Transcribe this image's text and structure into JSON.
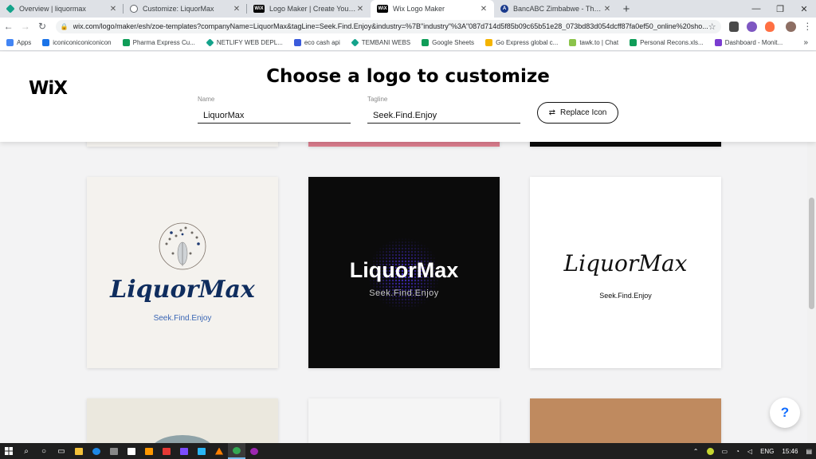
{
  "browser": {
    "tabs": [
      {
        "title": "Overview | liquormax",
        "favicon": "netlify-diamond-icon",
        "color": "#14a38b",
        "glyph": ""
      },
      {
        "title": "Customize: LiquorMax",
        "favicon": "globe-icon",
        "color": "#5f6368",
        "glyph": ""
      },
      {
        "title": "Logo Maker | Create Your Own F",
        "favicon": "wix-icon",
        "color": "#000000",
        "glyph": "WiX"
      },
      {
        "title": "Wix Logo Maker",
        "favicon": "wix-icon",
        "color": "#000000",
        "glyph": "WiX"
      },
      {
        "title": "BancABC Zimbabwe - The #ATeam",
        "favicon": "bancabc-icon",
        "color": "#1a3a8c",
        "glyph": "A"
      }
    ],
    "active_tab": 3,
    "url": "wix.com/logo/maker/esh/zoe-templates?companyName=LiquorMax&tagLine=Seek.Find.Enjoy&industry=%7B\"industry\"%3A\"087d714d5f85b09c65b51e28_073bd83d054dcff87fa0ef50_online%20sho...",
    "bookmarks": [
      {
        "label": "Apps",
        "color": "#4285f4"
      },
      {
        "label": "iconiconiconiconicon",
        "color": "#1a73e8"
      },
      {
        "label": "Pharma Express Cu...",
        "color": "#0f9d58"
      },
      {
        "label": "NETLIFY WEB DEPL...",
        "color": "#14a38b"
      },
      {
        "label": "eco cash api",
        "color": "#3b5bdb"
      },
      {
        "label": "TEMBANI WEBS",
        "color": "#14a38b"
      },
      {
        "label": "Google Sheets",
        "color": "#0f9d58"
      },
      {
        "label": "Go Express global c...",
        "color": "#f4b400"
      },
      {
        "label": "tawk.to | Chat",
        "color": "#8bc34a"
      },
      {
        "label": "Personal Recons.xls...",
        "color": "#0f9d58"
      },
      {
        "label": "Dashboard - Monit...",
        "color": "#7a3cd0"
      }
    ],
    "more_glyph": "»"
  },
  "wix": {
    "logo": "WiX",
    "title": "Choose a logo to customize",
    "name_label": "Name",
    "name_value": "LiquorMax",
    "tagline_label": "Tagline",
    "tagline_value": "Seek.Find.Enjoy",
    "replace_icon_label": "Replace Icon",
    "help_label": "?"
  },
  "logos": [
    {
      "brand": "LiquorMax",
      "tagline": "Seek.Find.Enjoy",
      "bg": "#f4f2ee",
      "brand_color": "#0f2d5e",
      "tagline_color": "#3a66b4"
    },
    {
      "brand": "LiquorMax",
      "tagline": "Seek.Find.Enjoy",
      "bg": "#0b0b0b",
      "brand_color": "#ffffff",
      "tagline_color": "#c9c9c9"
    },
    {
      "brand": "LiquorMax",
      "tagline": "Seek.Find.Enjoy",
      "bg": "#ffffff",
      "brand_color": "#111111",
      "tagline_color": "#111111"
    }
  ],
  "partial_rows": {
    "top_colors": [
      "#f4f2ee",
      "#d97b8b",
      "#0b0b0b"
    ],
    "bottom_colors": [
      "#ebe8de",
      "#f5f5f5",
      "#bf8a5f"
    ]
  },
  "taskbar": {
    "apps": [
      {
        "name": "file-explorer-icon",
        "color": "#f3c13a"
      },
      {
        "name": "edge-icon",
        "color": "#1e88e5"
      },
      {
        "name": "photos-icon",
        "color": "#888888"
      },
      {
        "name": "store-icon",
        "color": "#ffffff"
      },
      {
        "name": "sublime-icon",
        "color": "#ff9800"
      },
      {
        "name": "mail-icon",
        "color": "#e53935"
      },
      {
        "name": "infinity-icon",
        "color": "#7c4dff"
      },
      {
        "name": "vscode-icon",
        "color": "#29b6f6"
      },
      {
        "name": "vlc-icon",
        "color": "#ff7f00"
      },
      {
        "name": "chrome-icon",
        "color": "#34a853"
      },
      {
        "name": "app-icon",
        "color": "#9c27b0"
      }
    ],
    "lang": "ENG",
    "time": "15:46"
  }
}
